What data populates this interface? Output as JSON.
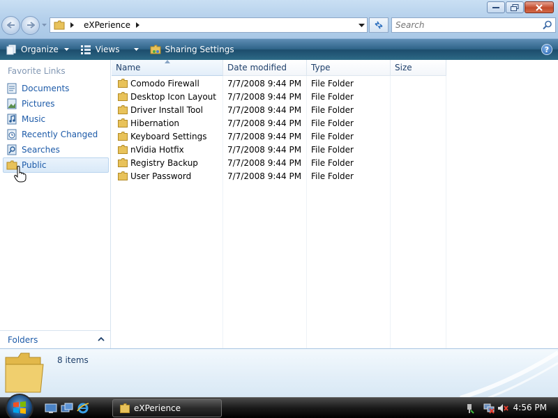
{
  "window": {
    "title": "eXPerience",
    "controls": [
      "minimize-icon",
      "maximize-icon",
      "close-icon"
    ]
  },
  "address_bar": {
    "segments": [
      "eXPerience"
    ],
    "search_placeholder": "Search"
  },
  "toolbar": {
    "organize_label": "Organize",
    "views_label": "Views",
    "sharing_label": "Sharing Settings"
  },
  "favorites": {
    "title": "Favorite Links",
    "items": [
      {
        "label": "Documents",
        "icon": "documents-icon"
      },
      {
        "label": "Pictures",
        "icon": "pictures-icon"
      },
      {
        "label": "Music",
        "icon": "music-icon"
      },
      {
        "label": "Recently Changed",
        "icon": "recently-changed-icon"
      },
      {
        "label": "Searches",
        "icon": "searches-icon"
      },
      {
        "label": "Public",
        "icon": "public-folder-icon",
        "selected": true
      }
    ],
    "folders_label": "Folders"
  },
  "file_list": {
    "columns": [
      "Name",
      "Date modified",
      "Type",
      "Size"
    ],
    "sorted_column": "Name",
    "rows": [
      {
        "name": "Comodo Firewall",
        "date": "7/7/2008 9:44 PM",
        "type": "File Folder",
        "size": ""
      },
      {
        "name": "Desktop Icon Layout",
        "date": "7/7/2008 9:44 PM",
        "type": "File Folder",
        "size": ""
      },
      {
        "name": "Driver Install Tool",
        "date": "7/7/2008 9:44 PM",
        "type": "File Folder",
        "size": ""
      },
      {
        "name": "Hibernation",
        "date": "7/7/2008 9:44 PM",
        "type": "File Folder",
        "size": ""
      },
      {
        "name": "Keyboard Settings",
        "date": "7/7/2008 9:44 PM",
        "type": "File Folder",
        "size": ""
      },
      {
        "name": "nVidia Hotfix",
        "date": "7/7/2008 9:44 PM",
        "type": "File Folder",
        "size": ""
      },
      {
        "name": "Registry Backup",
        "date": "7/7/2008 9:44 PM",
        "type": "File Folder",
        "size": ""
      },
      {
        "name": "User Password",
        "date": "7/7/2008 9:44 PM",
        "type": "File Folder",
        "size": ""
      }
    ]
  },
  "details_pane": {
    "item_count": "8 items"
  },
  "taskbar": {
    "active_window": "eXPerience",
    "clock": "4:56 PM"
  },
  "colors": {
    "toolbar": "#2f6489",
    "link": "#1c5aa8",
    "folder": "#e8c25a",
    "taskbar": "#1a1a1a"
  }
}
